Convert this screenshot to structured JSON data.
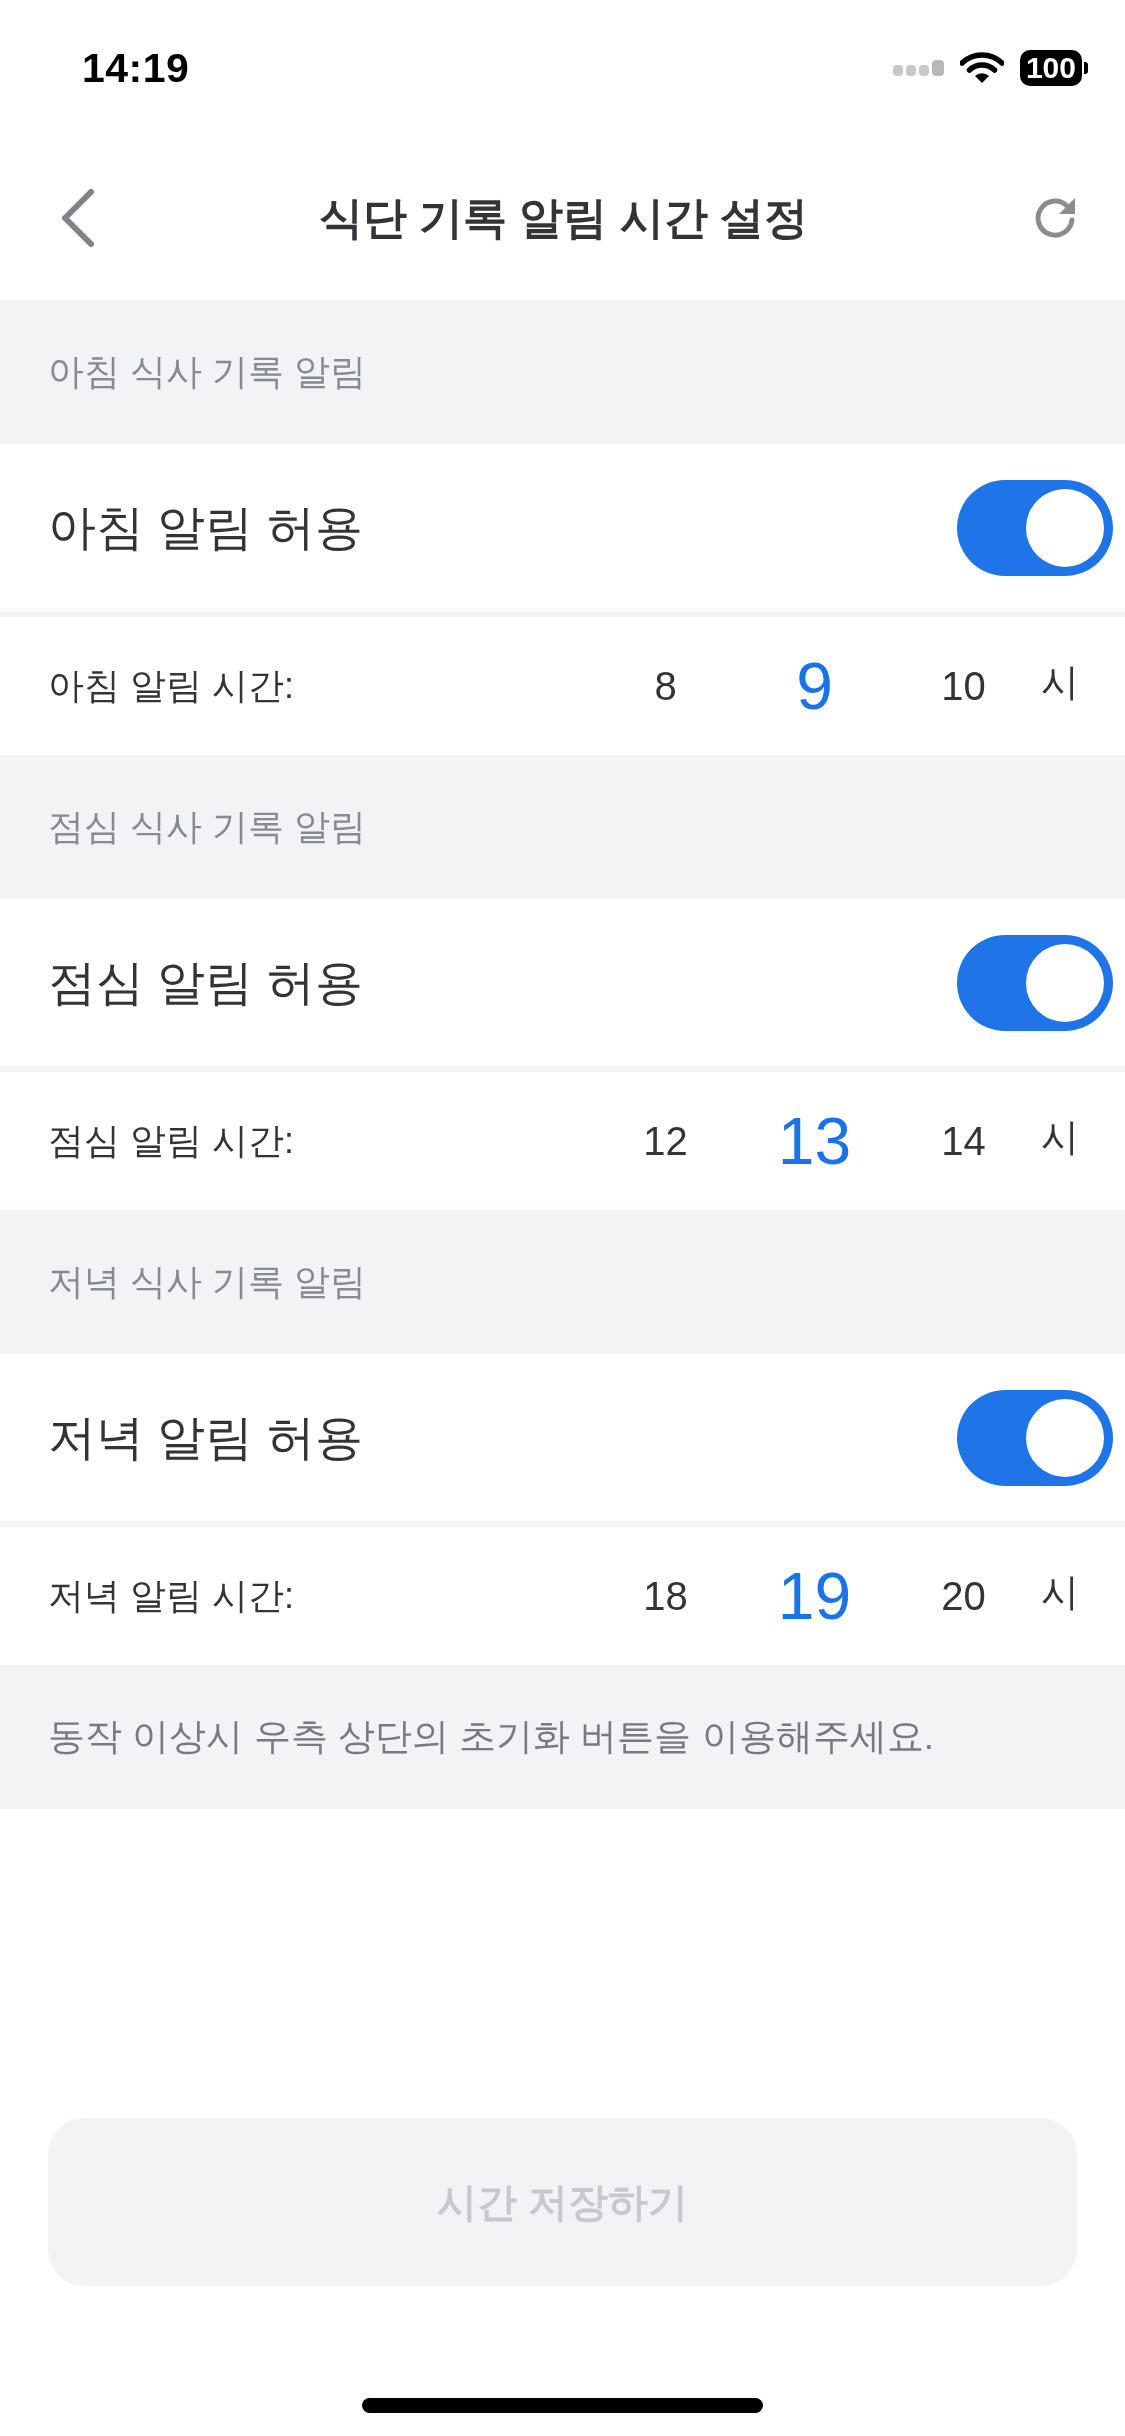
{
  "status_bar": {
    "time": "14:19",
    "battery": "100"
  },
  "nav": {
    "title": "식단 기록 알림 시간 설정"
  },
  "sections": [
    {
      "header": "아침 식사 기록 알림",
      "toggle": {
        "label": "아침 알림 허용",
        "on": true
      },
      "time_picker": {
        "label": "아침 알림 시간:",
        "options": [
          {
            "value": "8",
            "selected": false
          },
          {
            "value": "9",
            "selected": true
          },
          {
            "value": "10",
            "selected": false
          }
        ],
        "unit": "시"
      }
    },
    {
      "header": "점심 식사 기록 알림",
      "toggle": {
        "label": "점심 알림 허용",
        "on": true
      },
      "time_picker": {
        "label": "점심 알림 시간:",
        "options": [
          {
            "value": "12",
            "selected": false
          },
          {
            "value": "13",
            "selected": true
          },
          {
            "value": "14",
            "selected": false
          }
        ],
        "unit": "시"
      }
    },
    {
      "header": "저녁 식사 기록 알림",
      "toggle": {
        "label": "저녁 알림 허용",
        "on": true
      },
      "time_picker": {
        "label": "저녁 알림 시간:",
        "options": [
          {
            "value": "18",
            "selected": false
          },
          {
            "value": "19",
            "selected": true
          },
          {
            "value": "20",
            "selected": false
          }
        ],
        "unit": "시"
      }
    }
  ],
  "notice": "동작 이상시 우측 상단의 초기화 버튼을 이용해주세요.",
  "save_button": {
    "label": "시간 저장하기",
    "disabled": true
  }
}
